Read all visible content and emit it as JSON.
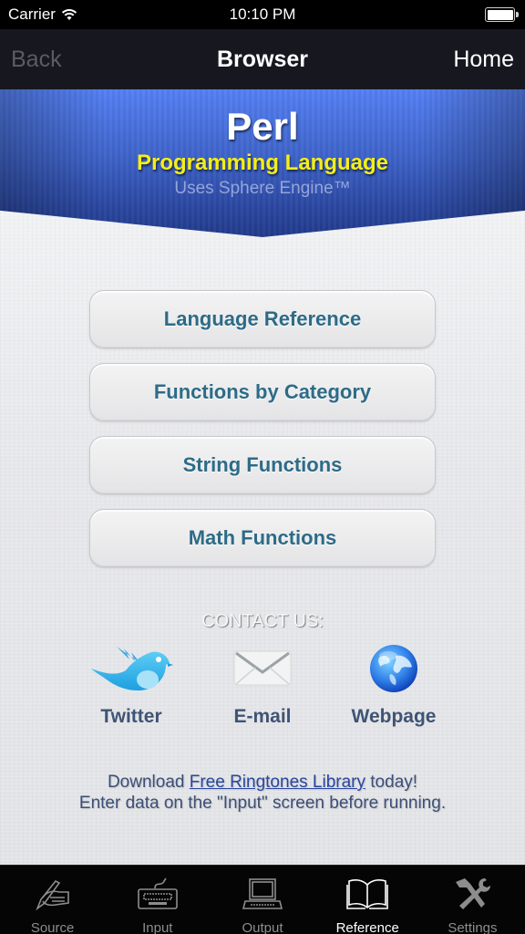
{
  "status_bar": {
    "carrier": "Carrier",
    "time": "10:10 PM",
    "battery_level": 1.0
  },
  "nav_bar": {
    "back_label": "Back",
    "title": "Browser",
    "home_label": "Home"
  },
  "banner": {
    "language": "Perl",
    "subtitle": "Programming Language",
    "engine": "Uses Sphere Engine™"
  },
  "menu": {
    "items": [
      {
        "label": "Language Reference"
      },
      {
        "label": "Functions by Category"
      },
      {
        "label": "String Functions"
      },
      {
        "label": "Math Functions"
      }
    ]
  },
  "contact": {
    "title": "CONTACT US:",
    "items": [
      {
        "label": "Twitter",
        "icon": "twitter-bird-icon"
      },
      {
        "label": "E-mail",
        "icon": "envelope-icon"
      },
      {
        "label": "Webpage",
        "icon": "globe-icon"
      }
    ]
  },
  "footer": {
    "download_prefix": "Download ",
    "download_link": "Free Ringtones Library",
    "download_suffix": " today!",
    "hint": "Enter data on the \"Input\" screen before running."
  },
  "tab_bar": {
    "active": "Reference",
    "tabs": [
      {
        "label": "Source",
        "icon": "hand-pen-icon"
      },
      {
        "label": "Input",
        "icon": "keyboard-icon"
      },
      {
        "label": "Output",
        "icon": "laptop-icon"
      },
      {
        "label": "Reference",
        "icon": "open-book-icon"
      },
      {
        "label": "Settings",
        "icon": "tools-icon"
      }
    ]
  },
  "colors": {
    "banner_blue": "#3e63c9",
    "subtitle_yellow": "#f5ee18",
    "button_text": "#2d6b87",
    "contact_label": "#3f5475",
    "tab_active": "#ffffff",
    "tab_inactive": "#8d8d8d"
  }
}
